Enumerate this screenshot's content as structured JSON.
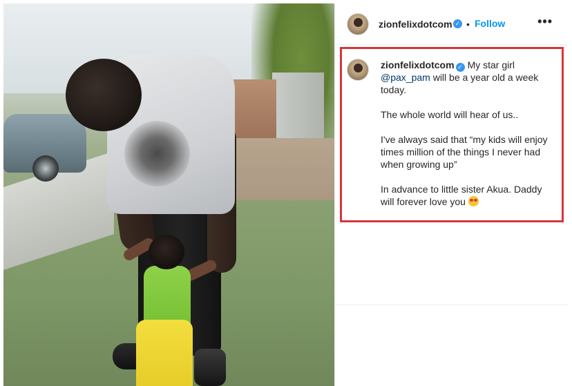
{
  "post": {
    "header": {
      "username": "zionfelixdotcom",
      "verified_mark": "✓",
      "separator": "•",
      "follow_label": "Follow",
      "more_label": "•••"
    },
    "caption": {
      "username": "zionfelixdotcom",
      "verified_mark": "✓",
      "line1_start": "My star girl ",
      "mention": "@pax_pam",
      "line1_end": " will be a year old a week today.",
      "para2": "The whole world will hear of us..",
      "para3": "I've always said that “my kids will enjoy times million of the things I never had when growing up”",
      "para4": "In advance to little sister Akua. Daddy will forever love you",
      "emoji": "star-struck-emoji"
    }
  },
  "colors": {
    "accent": "#0095f6",
    "verified": "#3897f0",
    "highlight_border": "#d9343a"
  }
}
